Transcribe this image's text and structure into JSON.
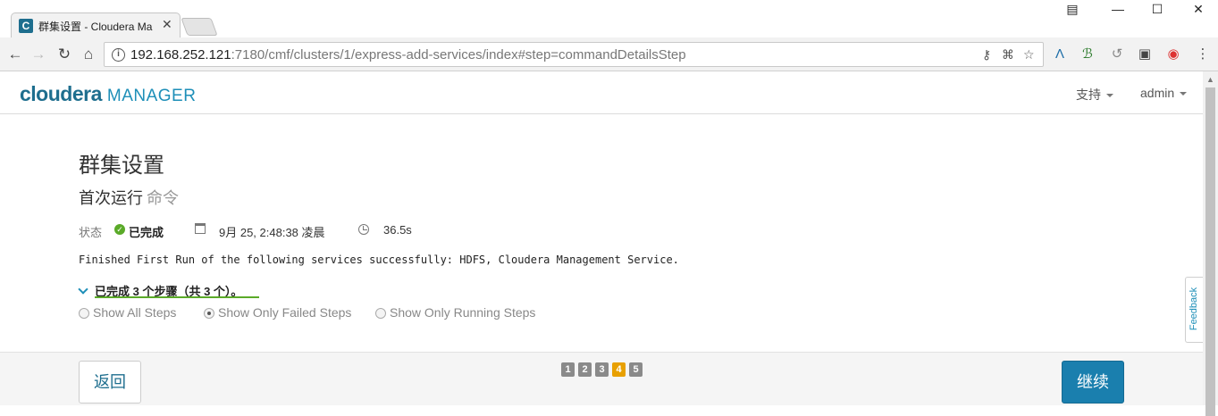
{
  "browser": {
    "tab_title": "群集设置 - Cloudera Ma",
    "tab_favicon": "C",
    "url_host": "192.168.252.121",
    "url_rest": ":7180/cmf/clusters/1/express-add-services/index#step=commandDetailsStep"
  },
  "header": {
    "logo_main": "cloudera",
    "logo_sub": "MANAGER",
    "support_label": "支持",
    "user_label": "admin"
  },
  "main": {
    "title": "群集设置",
    "subtitle": "首次运行",
    "subtitle_muted": "命令",
    "status_label": "状态",
    "status_value": "已完成",
    "date_value": "9月 25, 2:48:38 凌晨",
    "duration_value": "36.5s",
    "result_message": "Finished First Run of the following services successfully: HDFS, Cloudera Management Service.",
    "steps_summary": "已完成 3 个步骤（共 3 个）。",
    "filters": [
      {
        "label": "Show All Steps",
        "selected": false
      },
      {
        "label": "Show Only Failed Steps",
        "selected": true
      },
      {
        "label": "Show Only Running Steps",
        "selected": false
      }
    ]
  },
  "footer": {
    "back_label": "返回",
    "continue_label": "继续",
    "pages": [
      "1",
      "2",
      "3",
      "4",
      "5"
    ],
    "current_page": "4"
  },
  "feedback_label": "Feedback",
  "colors": {
    "brand": "#1e6e8e",
    "accent": "#1a7fae",
    "success": "#5aaa28",
    "current_step": "#e8a000"
  }
}
